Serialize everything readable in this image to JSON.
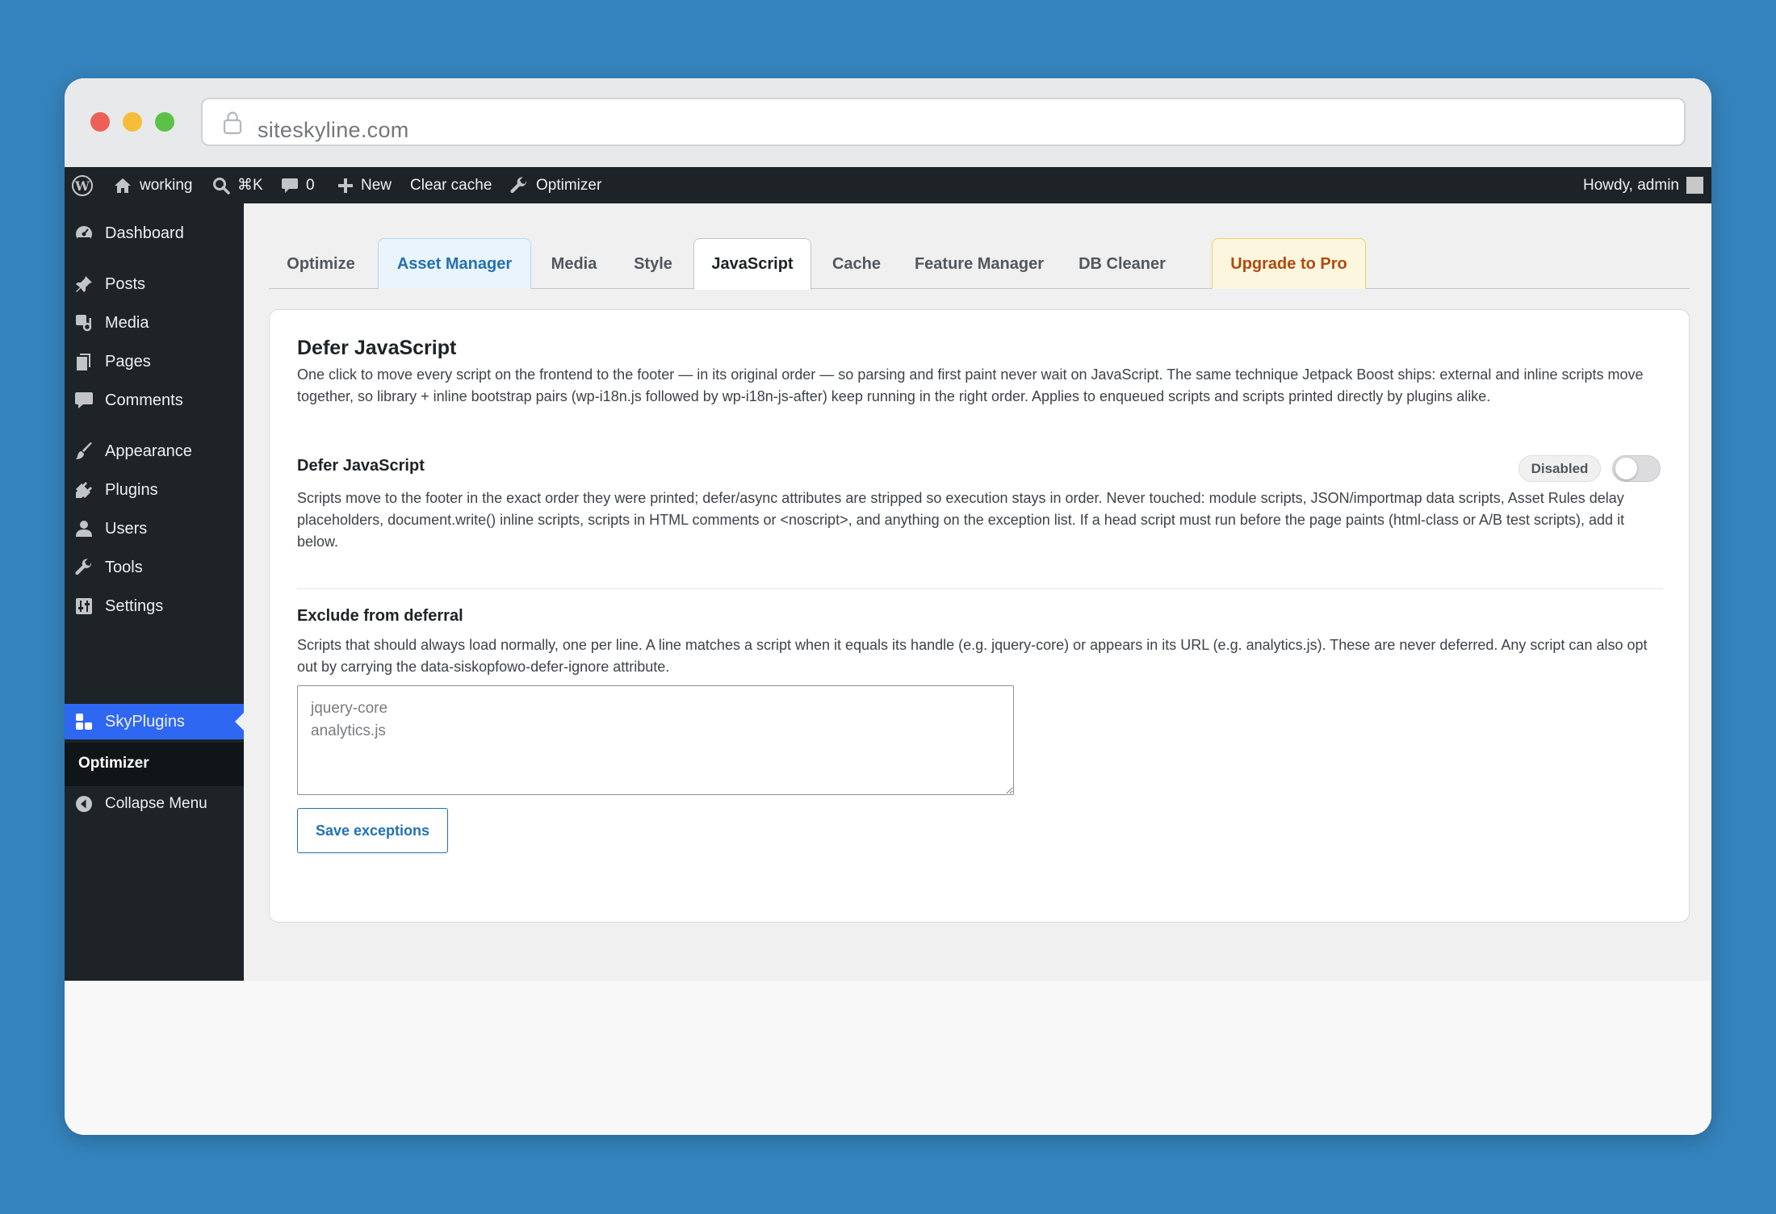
{
  "browser": {
    "url": "siteskyline.com"
  },
  "admin_bar": {
    "site_name": "working",
    "search_shortcut": "⌘K",
    "comments_count": "0",
    "new_label": "New",
    "clear_cache_label": "Clear cache",
    "optimizer_label": "Optimizer",
    "howdy": "Howdy, admin"
  },
  "sidebar": {
    "items": [
      {
        "label": "Dashboard",
        "icon": "dashboard-icon"
      },
      {
        "label": "Posts",
        "icon": "pin-icon"
      },
      {
        "label": "Media",
        "icon": "media-icon"
      },
      {
        "label": "Pages",
        "icon": "pages-icon"
      },
      {
        "label": "Comments",
        "icon": "comment-icon"
      },
      {
        "label": "Appearance",
        "icon": "brush-icon"
      },
      {
        "label": "Plugins",
        "icon": "plug-icon"
      },
      {
        "label": "Users",
        "icon": "user-icon"
      },
      {
        "label": "Tools",
        "icon": "wrench-icon"
      },
      {
        "label": "Settings",
        "icon": "settings-icon"
      },
      {
        "label": "SkyPlugins",
        "icon": "skyplugins-icon",
        "active": true
      }
    ],
    "submenu_item": "Optimizer",
    "collapse_label": "Collapse Menu"
  },
  "tabs": [
    {
      "label": "Optimize"
    },
    {
      "label": "Asset Manager"
    },
    {
      "label": "Media"
    },
    {
      "label": "Style"
    },
    {
      "label": "JavaScript",
      "active": true
    },
    {
      "label": "Cache"
    },
    {
      "label": "Feature Manager"
    },
    {
      "label": "DB Cleaner"
    },
    {
      "label": "Upgrade to Pro"
    }
  ],
  "card": {
    "title": "Defer JavaScript",
    "intro": "One click to move every script on the frontend to the footer — in its original order — so parsing and first paint never wait on JavaScript. The same technique Jetpack Boost ships: external and inline scripts move together, so library + inline bootstrap pairs (wp-i18n.js followed by wp-i18n-js-after) keep running in the right order. Applies to enqueued scripts and scripts printed directly by plugins alike.",
    "defer_setting": {
      "label": "Defer JavaScript",
      "status": "Disabled",
      "enabled": false,
      "description": "Scripts move to the footer in the exact order they were printed; defer/async attributes are stripped so execution stays in order. Never touched: module scripts, JSON/importmap data scripts, Asset Rules delay placeholders, document.write() inline scripts, scripts in HTML comments or <noscript>, and anything on the exception list. If a head script must run before the page paints (html-class or A/B test scripts), add it below."
    },
    "exclude": {
      "label": "Exclude from deferral",
      "description": "Scripts that should always load normally, one per line. A line matches a script when it equals its handle (e.g. jquery-core) or appears in its URL (e.g. analytics.js). These are never deferred. Any script can also opt out by carrying the data-siskopfowo-defer-ignore attribute.",
      "placeholder": "jquery-core\nanalytics.js",
      "value": ""
    },
    "save_label": "Save exceptions"
  },
  "colors": {
    "page_background": "#3583bd",
    "admin_dark": "#1d2327",
    "active_menu": "#2e67f2",
    "link_blue": "#2271b1",
    "pro_orange": "#b04a0c"
  }
}
